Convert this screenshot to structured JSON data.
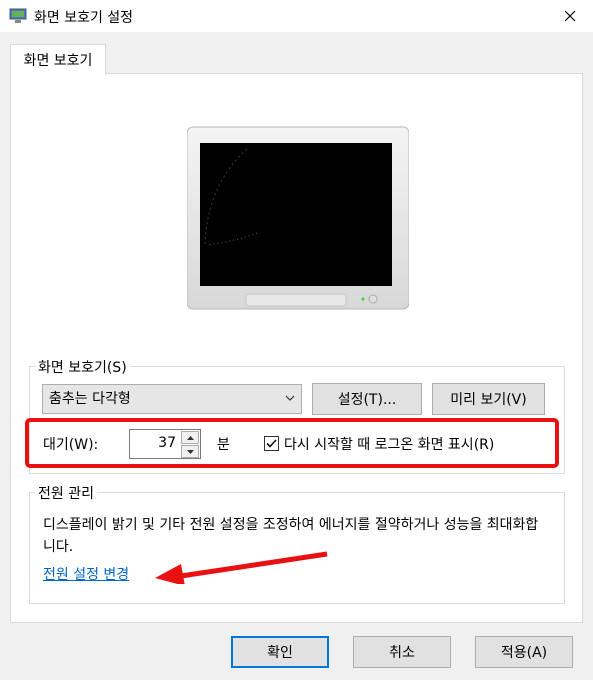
{
  "window": {
    "title": "화면 보호기 설정"
  },
  "tab": {
    "label": "화면 보호기"
  },
  "screensaver": {
    "group_label": "화면 보호기(S)",
    "selected": "춤추는 다각형",
    "settings_button": "설정(T)...",
    "preview_button": "미리 보기(V)"
  },
  "wait": {
    "label": "대기(W):",
    "value": "37",
    "unit": "분",
    "logon_checkbox_label": "다시 시작할 때 로그온 화면 표시(R)",
    "logon_checked": true
  },
  "power": {
    "group_label": "전원 관리",
    "description": "디스플레이 밝기 및 기타 전원 설정을 조정하여 에너지를 절약하거나 성능을 최대화합니다.",
    "link_label": "전원 설정 변경"
  },
  "footer": {
    "ok_label": "확인",
    "cancel_label": "취소",
    "apply_label": "적용(A)"
  },
  "colors": {
    "annotation_red": "#e81010",
    "link_blue": "#0066cc",
    "default_button_border": "#0078d7"
  }
}
